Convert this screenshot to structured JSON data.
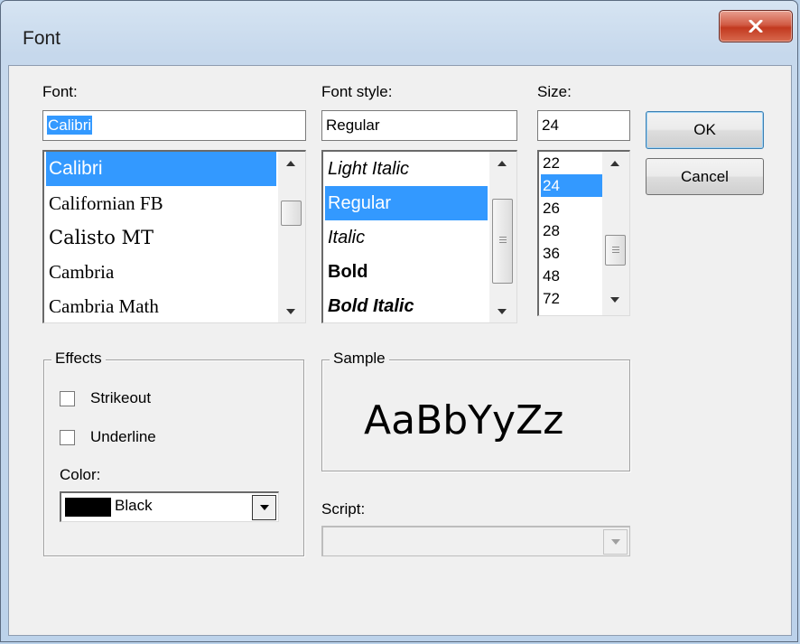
{
  "window": {
    "title": "Font"
  },
  "font": {
    "label": "Font:",
    "value": "Calibri",
    "items": [
      "Calibri",
      "Californian FB",
      "Calisto MT",
      "Cambria",
      "Cambria Math"
    ]
  },
  "font_style": {
    "label": "Font style:",
    "value": "Regular",
    "items": [
      "Light Italic",
      "Regular",
      "Italic",
      "Bold",
      "Bold Italic"
    ]
  },
  "size": {
    "label": "Size:",
    "value": "24",
    "items": [
      "22",
      "24",
      "26",
      "28",
      "36",
      "48",
      "72"
    ]
  },
  "buttons": {
    "ok": "OK",
    "cancel": "Cancel"
  },
  "effects": {
    "title": "Effects",
    "strikeout": "Strikeout",
    "underline": "Underline",
    "color_label": "Color:",
    "color_value": "Black",
    "color_swatch": "#000000"
  },
  "sample": {
    "title": "Sample",
    "text": "AaBbYyZz"
  },
  "script": {
    "label": "Script:",
    "value": ""
  },
  "colors": {
    "selection": "#3399ff",
    "close_button": "#c2391f"
  },
  "icons": {
    "close": "close-icon",
    "dropdown": "chevron-down-icon"
  }
}
